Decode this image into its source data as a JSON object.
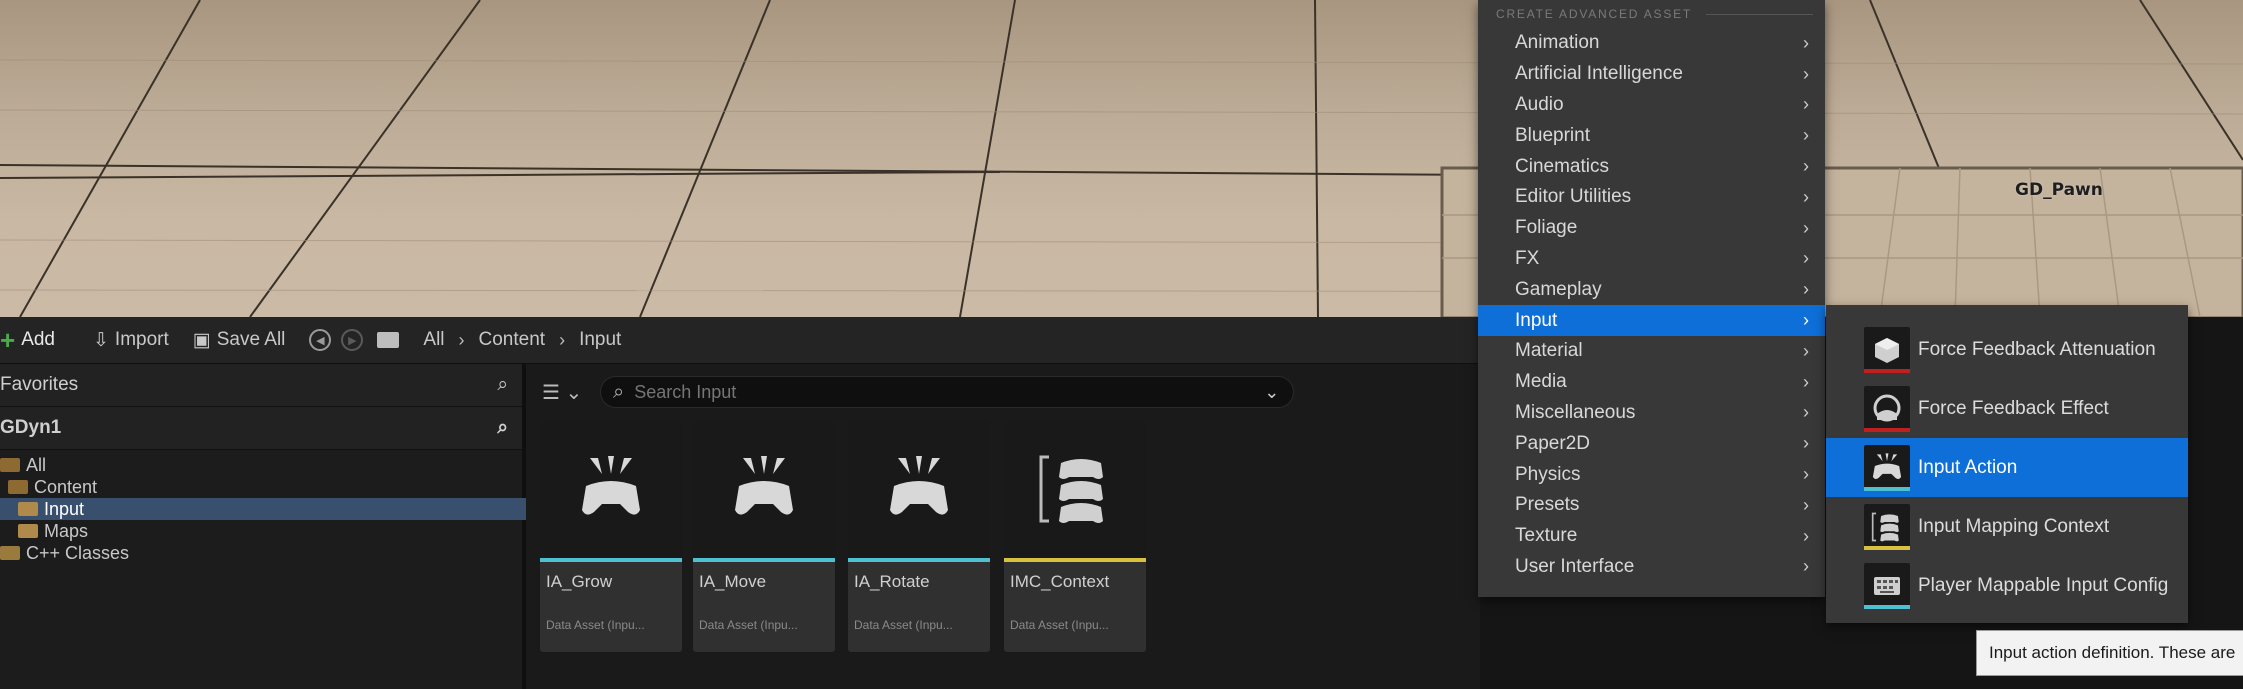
{
  "viewport": {
    "actor_label": "GD_Pawn"
  },
  "toolbar": {
    "add_label": "Add",
    "import_label": "Import",
    "save_all_label": "Save All",
    "breadcrumbs": [
      "All",
      "Content",
      "Input"
    ]
  },
  "left_panel": {
    "favorites_title": "Favorites",
    "project_title": "GDyn1",
    "tree": [
      {
        "label": "All"
      },
      {
        "label": "Content"
      },
      {
        "label": "Input"
      },
      {
        "label": "Maps"
      },
      {
        "label": "C++ Classes"
      }
    ]
  },
  "asset_area": {
    "search_placeholder": "Search Input",
    "assets": [
      {
        "name": "IA_Grow",
        "type": "Data Asset (Inpu...",
        "bar_color": "#4fc0d0",
        "icon": "gamepad-action-icon"
      },
      {
        "name": "IA_Move",
        "type": "Data Asset (Inpu...",
        "bar_color": "#4fc0d0",
        "icon": "gamepad-action-icon"
      },
      {
        "name": "IA_Rotate",
        "type": "Data Asset (Inpu...",
        "bar_color": "#4fc0d0",
        "icon": "gamepad-action-icon"
      },
      {
        "name": "IMC_Context",
        "type": "Data Asset (Inpu...",
        "bar_color": "#d8c040",
        "icon": "mapping-context-icon"
      }
    ]
  },
  "menu": {
    "header": "CREATE ADVANCED ASSET",
    "items": [
      {
        "label": "Animation"
      },
      {
        "label": "Artificial Intelligence"
      },
      {
        "label": "Audio"
      },
      {
        "label": "Blueprint"
      },
      {
        "label": "Cinematics"
      },
      {
        "label": "Editor Utilities"
      },
      {
        "label": "Foliage"
      },
      {
        "label": "FX"
      },
      {
        "label": "Gameplay"
      },
      {
        "label": "Input"
      },
      {
        "label": "Material"
      },
      {
        "label": "Media"
      },
      {
        "label": "Miscellaneous"
      },
      {
        "label": "Paper2D"
      },
      {
        "label": "Physics"
      },
      {
        "label": "Presets"
      },
      {
        "label": "Texture"
      },
      {
        "label": "User Interface"
      }
    ],
    "active_item": "Input"
  },
  "submenu": {
    "items": [
      {
        "label": "Force Feedback Attenuation",
        "stripe_color": "#c02020",
        "icon": "force-feedback-attenuation-icon"
      },
      {
        "label": "Force Feedback Effect",
        "stripe_color": "#c02020",
        "icon": "force-feedback-effect-icon"
      },
      {
        "label": "Input Action",
        "stripe_color": "#4fc0d0",
        "icon": "input-action-icon"
      },
      {
        "label": "Input Mapping Context",
        "stripe_color": "#d8c040",
        "icon": "input-mapping-context-icon"
      },
      {
        "label": "Player Mappable Input Config",
        "stripe_color": "#4fc0d0",
        "icon": "player-mappable-input-config-icon"
      }
    ],
    "active_item": "Input Action"
  },
  "tooltip": {
    "text": "Input action definition. These are"
  },
  "colors": {
    "accent": "#0e6fd8",
    "selection": "#384f6d",
    "add_green": "#4ca84c"
  }
}
